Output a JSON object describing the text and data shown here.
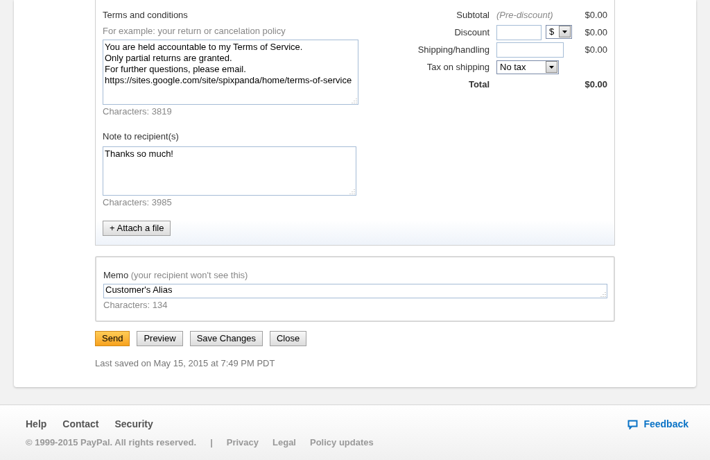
{
  "terms": {
    "label": "Terms and conditions",
    "hint": "For example: your return or cancelation policy",
    "value": "You are held accountable to my Terms of Service.\nOnly partial returns are granted.\nFor further questions, please email.\nhttps://sites.google.com/site/spixpanda/home/terms-of-service",
    "count": "Characters: 3819"
  },
  "note": {
    "label": "Note to recipient(s)",
    "value": "Thanks so much!",
    "count": "Characters: 3985"
  },
  "attach_button": "+ Attach a file",
  "totals": [
    {
      "kind": "text",
      "label": "Subtotal",
      "note": "(Pre-discount)",
      "amount": "$0.00"
    },
    {
      "kind": "input_select",
      "label": "Discount",
      "select": "$",
      "amount": "$0.00"
    },
    {
      "kind": "input",
      "label": "Shipping/handling",
      "amount": "$0.00"
    },
    {
      "kind": "select",
      "label": "Tax on shipping",
      "select": "No tax"
    },
    {
      "kind": "total",
      "label": "Total",
      "amount": "$0.00"
    }
  ],
  "memo": {
    "label": "Memo",
    "hint": "(your recipient won't see this)",
    "value": "Customer's Alias",
    "count": "Characters: 134"
  },
  "buttons": [
    {
      "label": "Send",
      "primary": true
    },
    {
      "label": "Preview",
      "primary": false
    },
    {
      "label": "Save Changes",
      "primary": false
    },
    {
      "label": "Close",
      "primary": false
    }
  ],
  "last_saved": "Last saved on May 15, 2015 at 7:49 PM PDT",
  "footer": {
    "links": [
      "Help",
      "Contact",
      "Security"
    ],
    "copyright": "© 1999-2015 PayPal. All rights reserved.",
    "separator": "|",
    "legal_links": [
      "Privacy",
      "Legal",
      "Policy updates"
    ],
    "feedback": "Feedback"
  }
}
